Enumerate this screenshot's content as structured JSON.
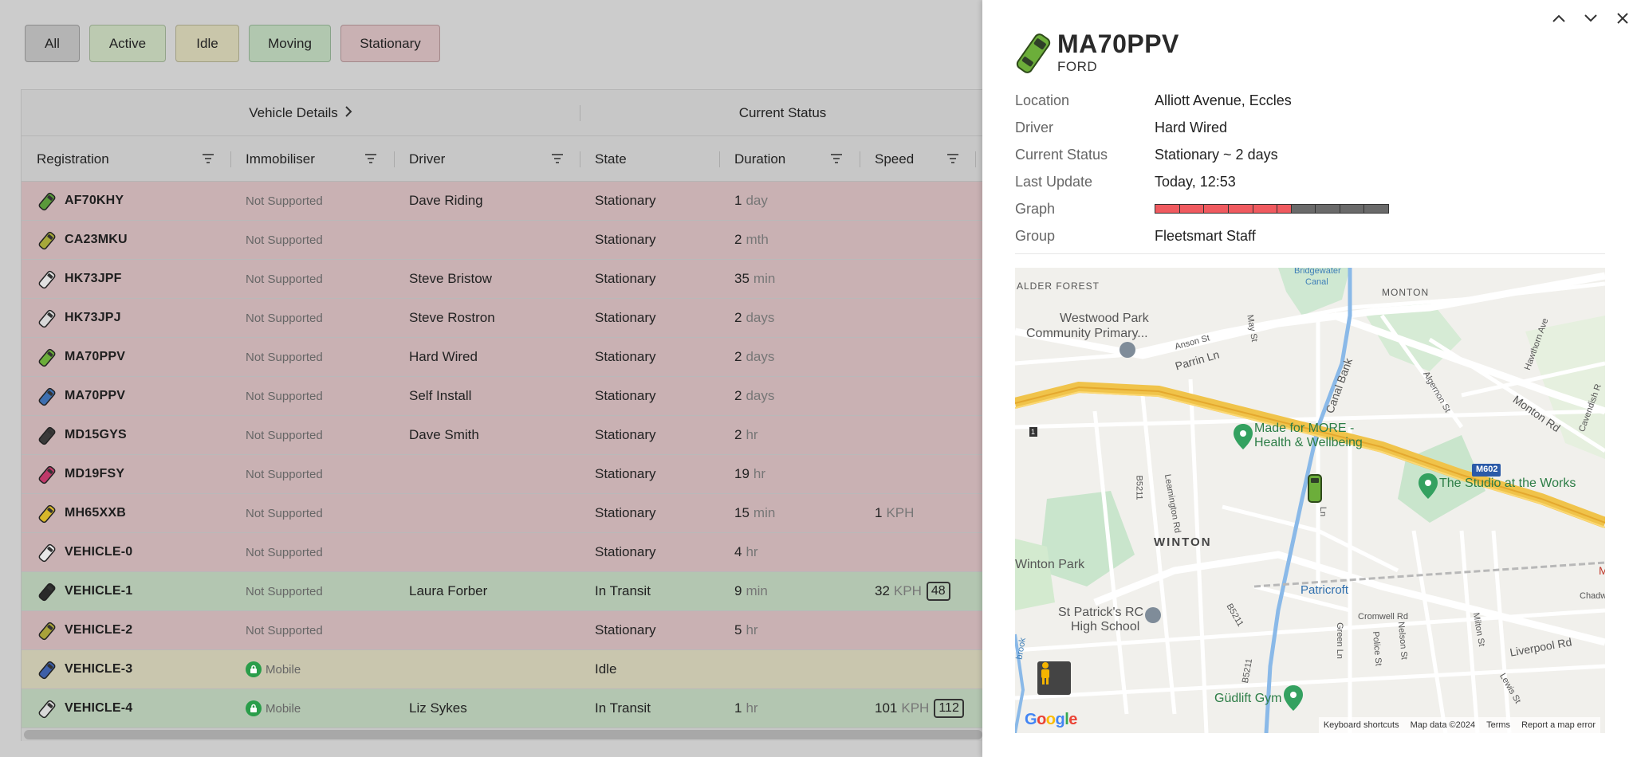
{
  "filters": [
    "All",
    "Active",
    "Idle",
    "Moving",
    "Stationary"
  ],
  "groups": {
    "vehicle_details": "Vehicle Details",
    "current_status": "Current Status"
  },
  "columns": {
    "registration": "Registration",
    "immobiliser": "Immobiliser",
    "driver": "Driver",
    "state": "State",
    "duration": "Duration",
    "speed": "Speed"
  },
  "rows": [
    {
      "reg": "AF70KHY",
      "imm": "Not Supported",
      "driver": "Dave Riding",
      "state": "Stationary",
      "dur": "1",
      "dur_unit": "day",
      "speed": "",
      "speed_unit": "",
      "limit": "",
      "color": "#5a9a3a"
    },
    {
      "reg": "CA23MKU",
      "imm": "Not Supported",
      "driver": "",
      "state": "Stationary",
      "dur": "2",
      "dur_unit": "mth",
      "speed": "",
      "speed_unit": "",
      "limit": "",
      "color": "#a6a83a"
    },
    {
      "reg": "HK73JPF",
      "imm": "Not Supported",
      "driver": "Steve Bristow",
      "state": "Stationary",
      "dur": "35",
      "dur_unit": "min",
      "speed": "",
      "speed_unit": "",
      "limit": "",
      "color": "#e0e0e0"
    },
    {
      "reg": "HK73JPJ",
      "imm": "Not Supported",
      "driver": "Steve Rostron",
      "state": "Stationary",
      "dur": "2",
      "dur_unit": "days",
      "speed": "",
      "speed_unit": "",
      "limit": "",
      "color": "#d8d8d8"
    },
    {
      "reg": "MA70PPV",
      "imm": "Not Supported",
      "driver": "Hard Wired",
      "state": "Stationary",
      "dur": "2",
      "dur_unit": "days",
      "speed": "",
      "speed_unit": "",
      "limit": "",
      "color": "#6cae3a"
    },
    {
      "reg": "MA70PPV",
      "imm": "Not Supported",
      "driver": "Self Install",
      "state": "Stationary",
      "dur": "2",
      "dur_unit": "days",
      "speed": "",
      "speed_unit": "",
      "limit": "",
      "color": "#3d6fb0"
    },
    {
      "reg": "MD15GYS",
      "imm": "Not Supported",
      "driver": "Dave Smith",
      "state": "Stationary",
      "dur": "2",
      "dur_unit": "hr",
      "speed": "",
      "speed_unit": "",
      "limit": "",
      "color": "#3a3a3a"
    },
    {
      "reg": "MD19FSY",
      "imm": "Not Supported",
      "driver": "",
      "state": "Stationary",
      "dur": "19",
      "dur_unit": "hr",
      "speed": "",
      "speed_unit": "",
      "limit": "",
      "color": "#c0396a"
    },
    {
      "reg": "MH65XXB",
      "imm": "Not Supported",
      "driver": "",
      "state": "Stationary",
      "dur": "15",
      "dur_unit": "min",
      "speed": "1",
      "speed_unit": "KPH",
      "limit": "",
      "color": "#d8b82a"
    },
    {
      "reg": "VEHICLE-0",
      "imm": "Not Supported",
      "driver": "",
      "state": "Stationary",
      "dur": "4",
      "dur_unit": "hr",
      "speed": "",
      "speed_unit": "",
      "limit": "",
      "color": "#e8e8e8"
    },
    {
      "reg": "VEHICLE-1",
      "imm": "Not Supported",
      "driver": "Laura Forber",
      "state": "In Transit",
      "dur": "9",
      "dur_unit": "min",
      "speed": "32",
      "speed_unit": "KPH",
      "limit": "48",
      "color": "#2a2a2a"
    },
    {
      "reg": "VEHICLE-2",
      "imm": "Not Supported",
      "driver": "",
      "state": "Stationary",
      "dur": "5",
      "dur_unit": "hr",
      "speed": "",
      "speed_unit": "",
      "limit": "",
      "color": "#a8a23a"
    },
    {
      "reg": "VEHICLE-3",
      "imm": "Mobile",
      "driver": "",
      "state": "Idle",
      "dur": "",
      "dur_unit": "",
      "speed": "",
      "speed_unit": "",
      "limit": "",
      "color": "#3d5fa8"
    },
    {
      "reg": "VEHICLE-4",
      "imm": "Mobile",
      "driver": "Liz Sykes",
      "state": "In Transit",
      "dur": "1",
      "dur_unit": "hr",
      "speed": "101",
      "speed_unit": "KPH",
      "limit": "112",
      "color": "#d8d8d8"
    }
  ],
  "detail": {
    "registration": "MA70PPV",
    "make": "FORD",
    "location_label": "Location",
    "location": "Alliott Avenue, Eccles",
    "driver_label": "Driver",
    "driver": "Hard Wired",
    "status_label": "Current Status",
    "status": "Stationary ~ 2 days",
    "update_label": "Last Update",
    "update": "Today, 12:53",
    "graph_label": "Graph",
    "group_label": "Group",
    "group": "Fleetsmart Staff",
    "icon_color": "#6cae3a"
  },
  "map": {
    "labels": {
      "alder_forest": "ALDER FOREST",
      "westwood": "Westwood Park",
      "community": "Community Primary...",
      "monton": "MONTON",
      "bridgewater": "Bridgewater",
      "canal": "Canal",
      "anson": "Anson St",
      "may": "May St",
      "parrin": "Parrin Ln",
      "canal_bank": "Canal Bank",
      "algernon": "Algernon St",
      "hawthorn": "Hawthorn Ave",
      "monton_rd": "Monton Rd",
      "cavendish": "Cavendish R",
      "made_for_more": "Made for MORE -",
      "health": "Health & Wellbeing",
      "m602": "M602",
      "studio": "The Studio at the Works",
      "b5211": "B5211",
      "leamington": "Leamington Rd",
      "ln": "Ln",
      "winton": "WINTON",
      "winton_park": "Winton Park",
      "patricroft": "Patricroft",
      "chadwick": "Chadwic",
      "st_patricks": "St Patrick's RC",
      "high_school": "High School",
      "cromwell": "Cromwell Rd",
      "nelson": "Nelson St",
      "police": "Police St",
      "milton": "Milton St",
      "green_ln": "Green Ln",
      "liverpool": "Liverpool Rd",
      "lewis": "Lewis St",
      "brook": "brook",
      "gudlift": "Güdlift Gym",
      "m": "M",
      "one": "1"
    },
    "google": "Google",
    "footer": [
      "Keyboard shortcuts",
      "Map data ©2024",
      "Terms",
      "Report a map error"
    ]
  }
}
